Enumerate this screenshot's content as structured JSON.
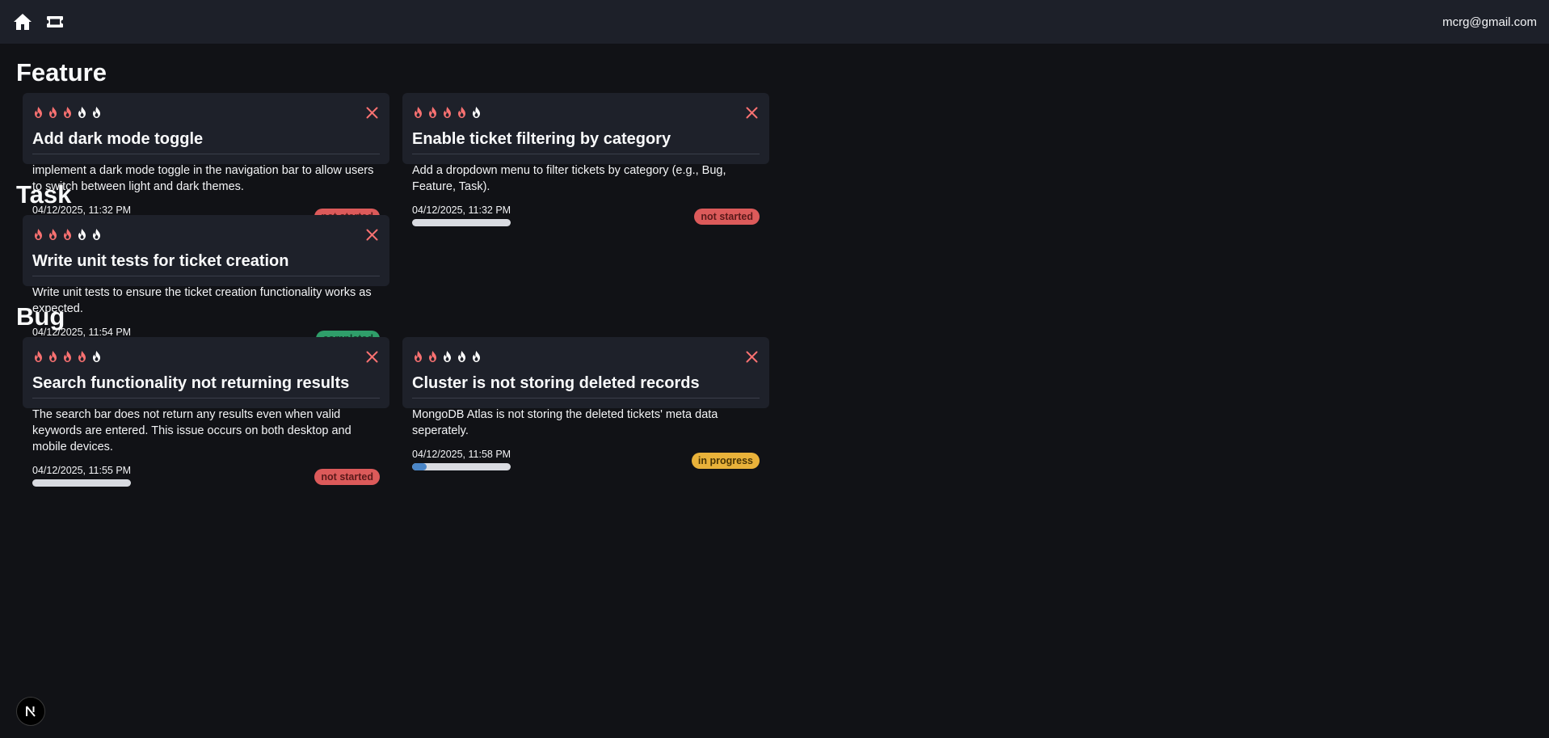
{
  "header": {
    "home_icon": "home-icon",
    "ticket_icon": "ticket-icon",
    "user_email": "mcrg@gmail.com"
  },
  "colors": {
    "flame_active": "#f87171",
    "flame_inactive": "#ffffff",
    "delete": "#f87171",
    "not_started": "#dc5a5a",
    "completed": "#2f9e6a",
    "in_progress": "#e9b23a",
    "progress_fill": "#4a86c8"
  },
  "sections": [
    {
      "title": "Feature",
      "cards": [
        {
          "priority": 3,
          "title": "Add dark mode toggle",
          "description": "implement a dark mode toggle in the navigation bar to allow users to switch between light and dark themes.",
          "timestamp": "04/12/2025, 11:32 PM",
          "progress": 0,
          "status": "not started",
          "status_key": "not_started"
        },
        {
          "priority": 4,
          "title": "Enable ticket filtering by category",
          "description": "Add a dropdown menu to filter tickets by category (e.g., Bug, Feature, Task).",
          "timestamp": "04/12/2025, 11:32 PM",
          "progress": 0,
          "status": "not started",
          "status_key": "not_started"
        }
      ]
    },
    {
      "title": "Task",
      "cards": [
        {
          "priority": 3,
          "title": "Write unit tests for ticket creation",
          "description": "Write unit tests to ensure the ticket creation functionality works as expected.",
          "timestamp": "04/12/2025, 11:54 PM",
          "progress": 100,
          "status": "completed",
          "status_key": "completed"
        }
      ]
    },
    {
      "title": "Bug",
      "cards": [
        {
          "priority": 4,
          "title": "Search functionality not returning results",
          "description": "The search bar does not return any results even when valid keywords are entered. This issue occurs on both desktop and mobile devices.",
          "timestamp": "04/12/2025, 11:55 PM",
          "progress": 0,
          "status": "not started",
          "status_key": "not_started"
        },
        {
          "priority": 2,
          "title": "Cluster is not storing deleted records",
          "description": "MongoDB Atlas is not storing the deleted tickets' meta data seperately.",
          "timestamp": "04/12/2025, 11:58 PM",
          "progress": 15,
          "status": "in progress",
          "status_key": "in_progress"
        }
      ]
    }
  ],
  "footer": {
    "logo_icon": "nextjs-logo-icon"
  }
}
